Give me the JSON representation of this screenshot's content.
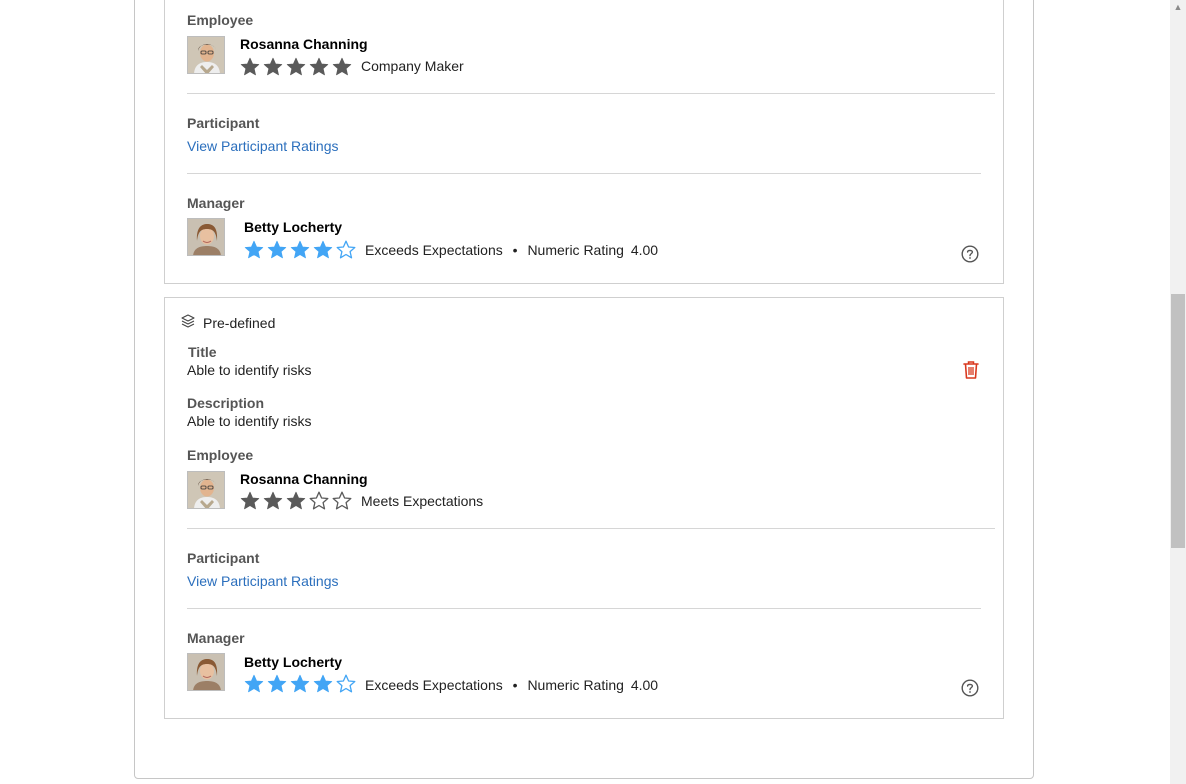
{
  "colors": {
    "link": "#2b6fbd",
    "star_employee": "#5a5a5a",
    "star_manager": "#42a5f5",
    "delete": "#d9381e"
  },
  "card1": {
    "employee": {
      "label": "Employee",
      "name": "Rosanna Channing",
      "rating_stars": 5,
      "rating_text": "Company Maker"
    },
    "participant": {
      "label": "Participant",
      "link": "View Participant Ratings"
    },
    "manager": {
      "label": "Manager",
      "name": "Betty Locherty",
      "rating_stars": 4,
      "rating_text": "Exceeds Expectations",
      "bullet": "•",
      "numeric_label": "Numeric Rating",
      "numeric_value": "4.00",
      "help_icon": "help-circle-icon"
    }
  },
  "card2": {
    "type_icon": "layers-icon",
    "type_label": "Pre-defined",
    "title": {
      "label": "Title",
      "value": "Able to identify risks"
    },
    "description": {
      "label": "Description",
      "value": "Able to identify risks"
    },
    "delete_icon": "trash-icon",
    "employee": {
      "label": "Employee",
      "name": "Rosanna Channing",
      "rating_stars": 3,
      "rating_text": "Meets Expectations"
    },
    "participant": {
      "label": "Participant",
      "link": "View Participant Ratings"
    },
    "manager": {
      "label": "Manager",
      "name": "Betty Locherty",
      "rating_stars": 4,
      "rating_text": "Exceeds Expectations",
      "bullet": "•",
      "numeric_label": "Numeric Rating",
      "numeric_value": "4.00",
      "help_icon": "help-circle-icon"
    }
  }
}
